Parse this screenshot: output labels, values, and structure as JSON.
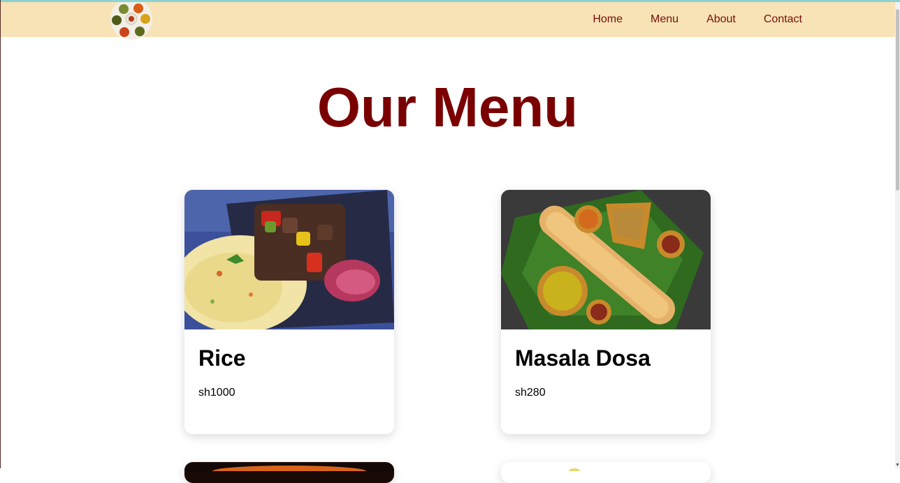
{
  "nav": {
    "links": [
      "Home",
      "Menu",
      "About",
      "Contact"
    ]
  },
  "main": {
    "title": "Our Menu"
  },
  "menu_items": [
    {
      "name": "Rice",
      "price": "sh1000"
    },
    {
      "name": "Masala Dosa",
      "price": "sh280"
    }
  ],
  "colors": {
    "nav_bg": "#f7e3b5",
    "accent": "#7a0000"
  },
  "icons": {
    "logo": "food-platter-logo-icon"
  }
}
